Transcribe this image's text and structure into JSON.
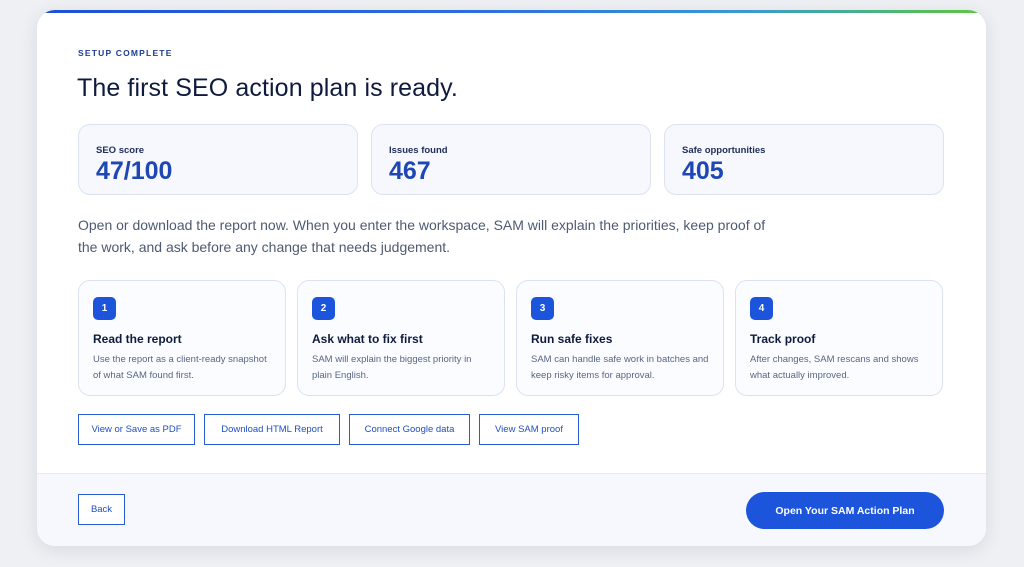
{
  "header": {
    "eyebrow": "SETUP COMPLETE",
    "title": "The first SEO action plan is ready."
  },
  "stats": [
    {
      "label": "SEO score",
      "value": "47/100"
    },
    {
      "label": "Issues found",
      "value": "467"
    },
    {
      "label": "Safe opportunities",
      "value": "405"
    }
  ],
  "description": "Open or download the report now. When you enter the workspace, SAM will explain the priorities, keep proof of the work, and ask before any change that needs judgement.",
  "steps": [
    {
      "number": "1",
      "title": "Read the report",
      "body": "Use the report as a client-ready snapshot of what SAM found first."
    },
    {
      "number": "2",
      "title": "Ask what to fix first",
      "body": "SAM will explain the biggest priority in plain English."
    },
    {
      "number": "3",
      "title": "Run safe fixes",
      "body": "SAM can handle safe work in batches and keep risky items for approval."
    },
    {
      "number": "4",
      "title": "Track proof",
      "body": "After changes, SAM rescans and shows what actually improved."
    }
  ],
  "actions": {
    "view_pdf": "View or Save as PDF",
    "download_html": "Download HTML Report",
    "connect_google": "Connect Google data",
    "view_proof": "View SAM proof"
  },
  "footer": {
    "back": "Back",
    "primary": "Open Your SAM Action Plan"
  },
  "colors": {
    "accent": "#1c54dc",
    "stat_value": "#1e46b4",
    "background": "#eef0f4"
  }
}
